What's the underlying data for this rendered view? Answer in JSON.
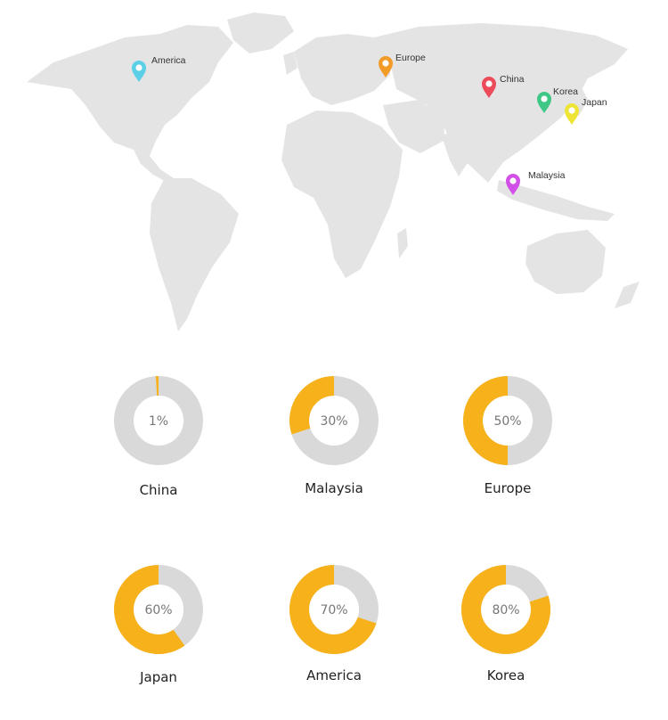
{
  "colors": {
    "land": "#e4e4e4",
    "ring_bg": "#d9d9d9",
    "ring_fill": "#f7b21b"
  },
  "pins": [
    {
      "label": "America",
      "color": "#5bcfe6",
      "icon": "map-marker-icon"
    },
    {
      "label": "Europe",
      "color": "#f29b28",
      "icon": "map-marker-icon"
    },
    {
      "label": "China",
      "color": "#ec4b5a",
      "icon": "map-marker-icon"
    },
    {
      "label": "Korea",
      "color": "#3fc785",
      "icon": "map-marker-icon"
    },
    {
      "label": "Japan",
      "color": "#eee436",
      "icon": "map-marker-icon"
    },
    {
      "label": "Malaysia",
      "color": "#d24fe8",
      "icon": "map-marker-icon"
    }
  ],
  "chart_data": {
    "type": "pie",
    "categories": [
      "China",
      "Malaysia",
      "Europe",
      "Japan",
      "America",
      "Korea"
    ],
    "values": [
      1,
      30,
      50,
      60,
      70,
      80
    ],
    "value_labels": [
      "1%",
      "30%",
      "50%",
      "60%",
      "70%",
      "80%"
    ],
    "unit": "%",
    "style": "donut"
  }
}
